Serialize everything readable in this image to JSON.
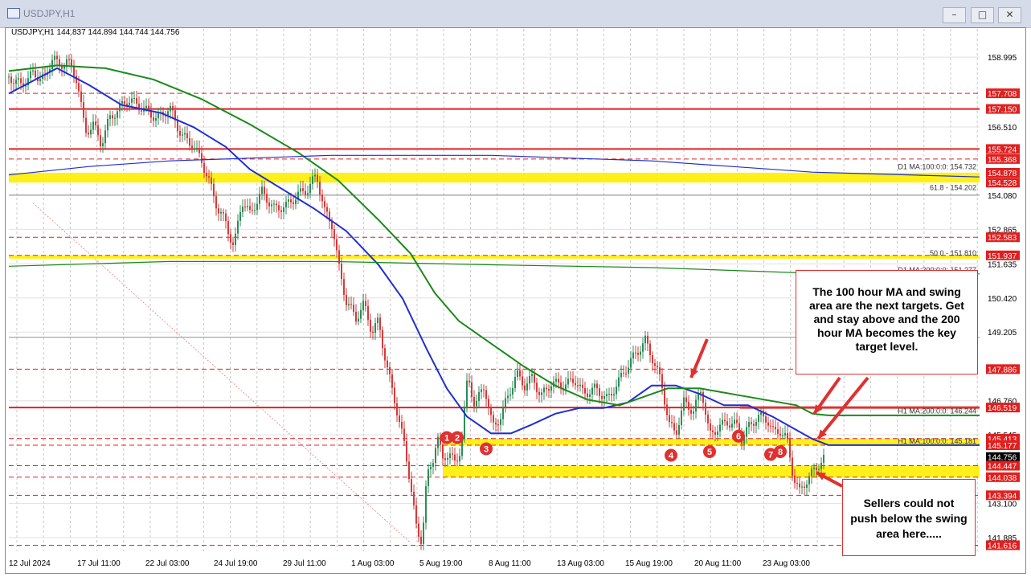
{
  "window": {
    "title": "USDJPY,H1",
    "buttons": [
      "–",
      "□",
      "✕"
    ]
  },
  "header": {
    "ohlc": "USDJPY,H1  144.837 144.894 144.744 144.756"
  },
  "chart_data": {
    "type": "line",
    "symbol": "USDJPY,H1",
    "ylim": [
      141.4,
      160.0
    ],
    "y_ticks": [
      "158.995",
      "156.510",
      "154.080",
      "152.865",
      "151.635",
      "150.420",
      "149.205",
      "146.760",
      "145.545",
      "143.100",
      "141.885"
    ],
    "x_ticks": [
      "12 Jul 2024",
      "17 Jul 11:00",
      "22 Jul 03:00",
      "24 Jul 19:00",
      "29 Jul 11:00",
      "1 Aug 03:00",
      "5 Aug 19:00",
      "8 Aug 11:00",
      "13 Aug 03:00",
      "15 Aug 19:00",
      "20 Aug 11:00",
      "23 Aug 03:00"
    ],
    "x_max": 1208,
    "price_path": [
      [
        0,
        158.3
      ],
      [
        15,
        158.0
      ],
      [
        30,
        158.4
      ],
      [
        45,
        158.2
      ],
      [
        55,
        159.1
      ],
      [
        62,
        158.6
      ],
      [
        72,
        158.9
      ],
      [
        85,
        158.2
      ],
      [
        95,
        156.3
      ],
      [
        105,
        156.6
      ],
      [
        115,
        155.9
      ],
      [
        125,
        156.8
      ],
      [
        135,
        157.1
      ],
      [
        148,
        157.5
      ],
      [
        160,
        157.3
      ],
      [
        175,
        157.0
      ],
      [
        185,
        156.8
      ],
      [
        200,
        157.2
      ],
      [
        215,
        156.2
      ],
      [
        228,
        155.9
      ],
      [
        240,
        155.3
      ],
      [
        250,
        154.5
      ],
      [
        260,
        153.6
      ],
      [
        270,
        153.1
      ],
      [
        280,
        152.2
      ],
      [
        290,
        153.9
      ],
      [
        300,
        153.4
      ],
      [
        315,
        154.2
      ],
      [
        330,
        153.6
      ],
      [
        345,
        153.7
      ],
      [
        360,
        154.1
      ],
      [
        372,
        154.3
      ],
      [
        383,
        154.8
      ],
      [
        393,
        153.5
      ],
      [
        403,
        153.0
      ],
      [
        410,
        151.6
      ],
      [
        420,
        150.3
      ],
      [
        432,
        149.7
      ],
      [
        442,
        150.2
      ],
      [
        452,
        149.2
      ],
      [
        460,
        149.6
      ],
      [
        470,
        148.0
      ],
      [
        480,
        146.8
      ],
      [
        492,
        145.2
      ],
      [
        500,
        143.8
      ],
      [
        508,
        142.0
      ],
      [
        514,
        141.8
      ],
      [
        520,
        144.0
      ],
      [
        527,
        144.5
      ],
      [
        533,
        145.6
      ],
      [
        540,
        144.6
      ],
      [
        548,
        145.0
      ],
      [
        556,
        144.4
      ],
      [
        563,
        145.2
      ],
      [
        571,
        147.6
      ],
      [
        580,
        146.6
      ],
      [
        592,
        147.3
      ],
      [
        602,
        145.8
      ],
      [
        612,
        146.2
      ],
      [
        622,
        147.0
      ],
      [
        632,
        147.7
      ],
      [
        642,
        147.3
      ],
      [
        652,
        147.6
      ],
      [
        662,
        146.9
      ],
      [
        675,
        147.4
      ],
      [
        690,
        147.3
      ],
      [
        705,
        147.5
      ],
      [
        715,
        147.0
      ],
      [
        730,
        147.2
      ],
      [
        745,
        146.8
      ],
      [
        760,
        147.5
      ],
      [
        772,
        148.1
      ],
      [
        782,
        148.5
      ],
      [
        792,
        148.9
      ],
      [
        802,
        148.2
      ],
      [
        812,
        147.4
      ],
      [
        822,
        145.9
      ],
      [
        830,
        145.6
      ],
      [
        840,
        146.7
      ],
      [
        852,
        146.4
      ],
      [
        862,
        147.2
      ],
      [
        872,
        145.5
      ],
      [
        882,
        145.8
      ],
      [
        894,
        146.0
      ],
      [
        905,
        145.9
      ],
      [
        912,
        145.4
      ],
      [
        920,
        145.8
      ],
      [
        932,
        146.2
      ],
      [
        944,
        146.1
      ],
      [
        952,
        145.6
      ],
      [
        960,
        145.7
      ],
      [
        968,
        145.4
      ],
      [
        976,
        144.1
      ],
      [
        984,
        143.5
      ],
      [
        992,
        143.9
      ],
      [
        1000,
        144.2
      ],
      [
        1008,
        144.5
      ],
      [
        1016,
        144.75
      ]
    ],
    "series": [
      {
        "name": "",
        "role": "ma100",
        "color": "#1f2fd0",
        "points": [
          [
            0,
            157.7
          ],
          [
            60,
            158.6
          ],
          [
            100,
            158.0
          ],
          [
            140,
            157.3
          ],
          [
            190,
            157.0
          ],
          [
            230,
            156.5
          ],
          [
            270,
            155.8
          ],
          [
            300,
            155.0
          ],
          [
            340,
            154.3
          ],
          [
            380,
            153.6
          ],
          [
            420,
            152.8
          ],
          [
            460,
            151.6
          ],
          [
            490,
            150.4
          ],
          [
            520,
            148.6
          ],
          [
            545,
            147.2
          ],
          [
            570,
            146.2
          ],
          [
            600,
            145.6
          ],
          [
            625,
            145.6
          ],
          [
            650,
            145.9
          ],
          [
            680,
            146.3
          ],
          [
            710,
            146.5
          ],
          [
            740,
            146.5
          ],
          [
            770,
            146.7
          ],
          [
            800,
            147.3
          ],
          [
            830,
            147.3
          ],
          [
            860,
            147.0
          ],
          [
            890,
            146.6
          ],
          [
            920,
            146.6
          ],
          [
            950,
            146.2
          ],
          [
            975,
            145.8
          ],
          [
            1000,
            145.4
          ],
          [
            1020,
            145.18
          ],
          [
            1208,
            145.18
          ]
        ]
      },
      {
        "name": "",
        "role": "ma200",
        "color": "#1a8a1a",
        "points": [
          [
            0,
            158.5
          ],
          [
            60,
            158.7
          ],
          [
            120,
            158.6
          ],
          [
            180,
            158.2
          ],
          [
            240,
            157.5
          ],
          [
            300,
            156.6
          ],
          [
            360,
            155.6
          ],
          [
            410,
            154.6
          ],
          [
            460,
            153.2
          ],
          [
            500,
            152.0
          ],
          [
            530,
            150.6
          ],
          [
            560,
            149.6
          ],
          [
            600,
            148.8
          ],
          [
            640,
            148.0
          ],
          [
            680,
            147.3
          ],
          [
            720,
            146.8
          ],
          [
            760,
            146.6
          ],
          [
            790,
            146.9
          ],
          [
            820,
            147.2
          ],
          [
            860,
            147.2
          ],
          [
            900,
            147.0
          ],
          [
            940,
            146.8
          ],
          [
            980,
            146.6
          ],
          [
            1000,
            146.3
          ],
          [
            1020,
            146.24
          ],
          [
            1208,
            146.24
          ]
        ]
      },
      {
        "name": "",
        "role": "d1ma100",
        "color": "#1f2fd0",
        "points": [
          [
            0,
            154.8
          ],
          [
            100,
            155.1
          ],
          [
            200,
            155.3
          ],
          [
            300,
            155.4
          ],
          [
            400,
            155.5
          ],
          [
            500,
            155.5
          ],
          [
            600,
            155.5
          ],
          [
            700,
            155.4
          ],
          [
            800,
            155.3
          ],
          [
            900,
            155.1
          ],
          [
            1000,
            154.9
          ],
          [
            1208,
            154.73
          ]
        ]
      },
      {
        "name": "",
        "role": "d1ma200",
        "color": "#1a8a1a",
        "points": [
          [
            0,
            151.55
          ],
          [
            200,
            151.72
          ],
          [
            400,
            151.72
          ],
          [
            600,
            151.6
          ],
          [
            800,
            151.5
          ],
          [
            1000,
            151.3
          ],
          [
            1208,
            151.277
          ]
        ]
      }
    ],
    "support_zones": [
      [
        154.53,
        154.88
      ],
      [
        151.82,
        151.94
      ],
      [
        145.18,
        145.41
      ],
      [
        144.04,
        144.45
      ]
    ],
    "red_lines": [
      157.708,
      157.15,
      155.724,
      155.368,
      152.583,
      151.937,
      147.886,
      146.519,
      145.413,
      145.177,
      144.447,
      144.038,
      143.394,
      141.616
    ],
    "red_solid": [
      157.15,
      155.724,
      146.519
    ],
    "line_labels": [
      {
        "text": "D1 MA:100:0:0: 154.732",
        "price": 154.95
      },
      {
        "text": "61.8 - 154.202",
        "price": 154.202
      },
      {
        "text": "50.0 - 151.810",
        "price": 151.88
      },
      {
        "text": "D1 MA:200:0:0: 151.277",
        "price": 151.277
      },
      {
        "text": "H1 MA:200:0:0: 146.244",
        "price": 146.244
      },
      {
        "text": "H1 MA:100:0:0: 145.181",
        "price": 145.181
      }
    ],
    "price_tags": [
      {
        "text": "157.708",
        "bg": "#e02020"
      },
      {
        "text": "157.150",
        "bg": "#e02020"
      },
      {
        "text": "155.724",
        "bg": "#e02020"
      },
      {
        "text": "155.368",
        "bg": "#e02020"
      },
      {
        "text": "154.878",
        "bg": "#e02020"
      },
      {
        "text": "154.528",
        "bg": "#e02020"
      },
      {
        "text": "152.583",
        "bg": "#e02020"
      },
      {
        "text": "151.937",
        "bg": "#e02020"
      },
      {
        "text": "147.886",
        "bg": "#e02020"
      },
      {
        "text": "146.519",
        "bg": "#e02020"
      },
      {
        "text": "145.413",
        "bg": "#e02020"
      },
      {
        "text": "145.177",
        "bg": "#e02020"
      },
      {
        "text": "144.756",
        "bg": "#000000"
      },
      {
        "text": "144.447",
        "bg": "#e02020"
      },
      {
        "text": "144.038",
        "bg": "#e02020"
      },
      {
        "text": "143.394",
        "bg": "#e02020"
      },
      {
        "text": "141.616",
        "bg": "#e02020"
      }
    ],
    "touch_markers": [
      {
        "label": "1",
        "x": 545,
        "price": 145.45
      },
      {
        "label": "2",
        "x": 558,
        "price": 145.45
      },
      {
        "label": "3",
        "x": 594,
        "price": 145.05
      },
      {
        "label": "4",
        "x": 824,
        "price": 144.82
      },
      {
        "label": "5",
        "x": 872,
        "price": 144.95
      },
      {
        "label": "6",
        "x": 908,
        "price": 145.5
      },
      {
        "label": "7",
        "x": 948,
        "price": 144.85
      },
      {
        "label": "8",
        "x": 960,
        "price": 144.95
      }
    ]
  },
  "annotations": {
    "upper": "The 100 hour MA and swing area are the next targets. Get and stay above and the 200 hour MA becomes the key target level.",
    "lower": "Sellers could not push below the swing area here....."
  },
  "colors": {
    "ma100": "#1f2fd0",
    "ma200": "#1a8a1a",
    "zone": "#ffee00",
    "level": "#e02020",
    "bull": "#2e8b57",
    "bear": "#d43a3a"
  }
}
